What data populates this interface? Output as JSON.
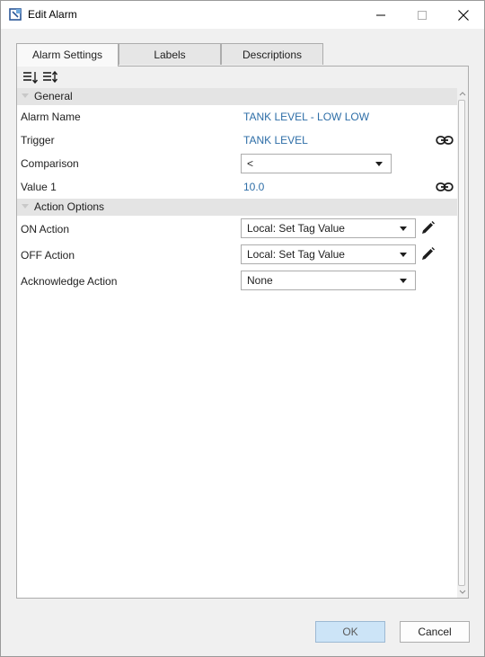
{
  "window": {
    "title": "Edit Alarm",
    "icon": "app-logo-icon",
    "controls": [
      "minimize-icon",
      "maximize-icon",
      "close-icon"
    ]
  },
  "tabs": [
    {
      "label": "Alarm Settings",
      "active": true
    },
    {
      "label": "Labels",
      "active": false
    },
    {
      "label": "Descriptions",
      "active": false
    }
  ],
  "toolbar": {
    "icons": [
      "sort-categorized-icon",
      "sort-alphabetical-icon"
    ]
  },
  "categories": {
    "general": "General",
    "action_options": "Action Options"
  },
  "properties": {
    "alarm_name": {
      "label": "Alarm Name",
      "value": "TANK LEVEL - LOW LOW"
    },
    "trigger": {
      "label": "Trigger",
      "value": "TANK LEVEL",
      "icon": "link-icon"
    },
    "comparison": {
      "label": "Comparison",
      "value": "<"
    },
    "value1": {
      "label": "Value 1",
      "value": "10.0",
      "icon": "link-icon"
    },
    "on_action": {
      "label": "ON Action",
      "value": "Local: Set Tag Value",
      "icon": "pencil-edit-icon"
    },
    "off_action": {
      "label": "OFF Action",
      "value": "Local: Set Tag Value",
      "icon": "pencil-edit-icon"
    },
    "ack_action": {
      "label": "Acknowledge Action",
      "value": "None"
    }
  },
  "buttons": {
    "ok": "OK",
    "cancel": "Cancel"
  },
  "colors": {
    "value_text": "#2e6ea7",
    "category_bg": "#e4e4e4",
    "ok_button_bg": "#cce4f7"
  }
}
